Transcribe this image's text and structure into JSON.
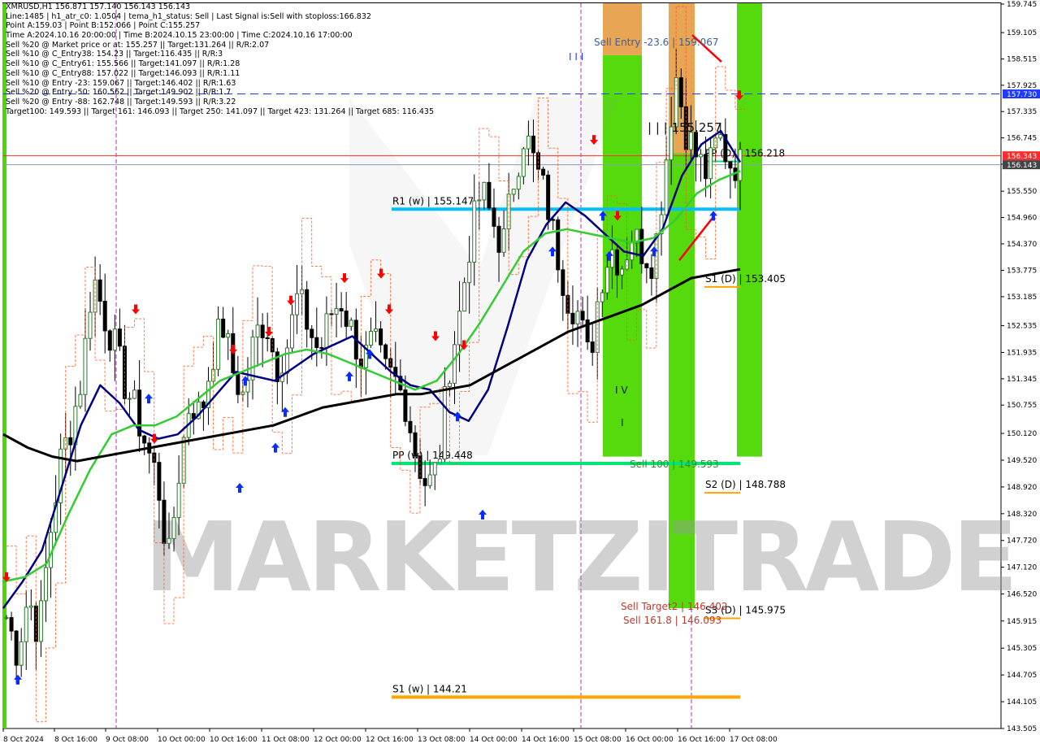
{
  "header": {
    "info_lines": [
      "XMRUSD,H1  156.871 157.140 156.143 156.143",
      "Line:1485  |  h1_atr_c0: 1.0504  |  tema_h1_status: Sell  |  Last Signal is:Sell with stoploss:166.832",
      "Point A:159.03  |  Point B:152.066  |  Point C:155.257",
      "Time A:2024.10.16 20:00:00  |  Time B:2024.10.15 23:00:00  |  Time C:2024.10.16 17:00:00",
      "Sell %20 @ Market price or at: 155.257  ||  Target:131.264  ||  R/R:2.07",
      "Sell %10 @ C_Entry38: 154.23  ||  Target:116.435  ||  R/R:3",
      "Sell %10 @ C_Entry61: 155.566  ||  Target:141.097  ||  R/R:1.28",
      "Sell %10 @ C_Entry88: 157.022  ||  Target:146.093  ||  R/R:1.11",
      "Sell %10 @ Entry -23: 159.067  ||  Target:146.402  ||  R/R:1.63",
      "Sell %20 @ Entry -50: 160.562  ||  Target:149.902  ||  R/R:1.7",
      "Sell %20 @ Entry -88: 162.748  ||  Target:149.593  ||  R/R:3.22",
      "Target100: 149.593  ||  Target 161: 146.093  ||  Target 250: 141.097  ||  Target 423: 131.264  ||  Target 685: 116.435"
    ]
  },
  "watermark": "MARKETZITRADE",
  "chart_data": {
    "type": "candlestick",
    "symbol": "XMRUSD",
    "timeframe": "H1",
    "ylim": [
      143.505,
      159.745
    ],
    "y_ticks": [
      "159.745",
      "159.105",
      "158.515",
      "157.925",
      "157.335",
      "156.745",
      "156.155",
      "155.550",
      "154.960",
      "154.370",
      "153.775",
      "153.185",
      "152.535",
      "151.935",
      "151.345",
      "150.755",
      "150.120",
      "149.520",
      "148.920",
      "148.320",
      "147.720",
      "147.120",
      "146.520",
      "145.915",
      "145.305",
      "144.705",
      "144.105",
      "143.505"
    ],
    "x_ticks": [
      "8 Oct 2024",
      "8 Oct 16:00",
      "9 Oct 08:00",
      "10 Oct 00:00",
      "10 Oct 16:00",
      "11 Oct 08:00",
      "12 Oct 00:00",
      "12 Oct 16:00",
      "13 Oct 08:00",
      "14 Oct 00:00",
      "14 Oct 16:00",
      "15 Oct 08:00",
      "16 Oct 00:00",
      "16 Oct 16:00",
      "17 Oct 08:00"
    ],
    "ohlc_close_path": [
      146.0,
      145.2,
      146.5,
      145.6,
      147.8,
      149.5,
      150.3,
      151.4,
      153.7,
      152.8,
      152.1,
      151.2,
      150.6,
      149.8,
      149.1,
      147.2,
      149.3,
      150.9,
      150.5,
      151.8,
      152.6,
      151.5,
      150.9,
      152.3,
      152.7,
      151.6,
      152.1,
      153.2,
      152.5,
      151.9,
      152.8,
      153.1,
      152.4,
      151.7,
      152.2,
      151.5,
      151.3,
      150.8,
      149.6,
      148.9,
      149.4,
      151.6,
      152.8,
      154.5,
      155.6,
      154.9,
      154.3,
      155.8,
      156.9,
      156.1,
      155.4,
      154.2,
      153.2,
      152.8,
      151.7,
      153.5,
      154.3,
      153.9,
      154.6,
      154.2,
      154.0,
      156.0,
      158.2,
      156.9,
      156.3,
      155.9,
      156.8,
      156.2,
      156.143
    ],
    "indicators": [
      {
        "name": "tema_h1",
        "color": "#000080",
        "values": [
          146.2,
          146.8,
          147.5,
          148.9,
          150.3,
          151.2,
          150.8,
          150.2,
          150.0,
          150.1,
          150.5,
          151.0,
          151.5,
          151.4,
          151.3,
          151.6,
          151.9,
          152.1,
          152.3,
          151.9,
          151.5,
          151.2,
          151.1,
          150.6,
          150.4,
          151.1,
          152.5,
          154.0,
          154.8,
          155.3,
          155.0,
          154.6,
          154.2,
          154.1,
          154.7,
          155.9,
          156.6,
          156.9,
          156.2
        ]
      },
      {
        "name": "ma_green",
        "color": "#33cc33",
        "values": [
          146.8,
          146.9,
          147.2,
          148.3,
          149.3,
          150.1,
          150.3,
          150.3,
          150.5,
          150.9,
          151.3,
          151.5,
          151.7,
          151.9,
          152.0,
          151.9,
          151.7,
          151.5,
          151.3,
          151.1,
          151.3,
          151.9,
          152.6,
          153.4,
          154.2,
          154.6,
          154.7,
          154.6,
          154.5,
          154.4,
          154.5,
          154.9,
          155.5,
          155.8,
          156.0
        ]
      },
      {
        "name": "ma_black",
        "color": "#000000",
        "values": [
          150.1,
          149.8,
          149.6,
          149.5,
          149.6,
          149.7,
          149.8,
          149.9,
          150.0,
          150.1,
          150.2,
          150.3,
          150.5,
          150.7,
          150.8,
          150.9,
          151.0,
          151.0,
          151.1,
          151.2,
          151.5,
          151.8,
          152.1,
          152.4,
          152.6,
          152.8,
          153.0,
          153.3,
          153.6,
          153.7,
          153.8
        ]
      }
    ],
    "levels": [
      {
        "label": "R1 (w) | 155.147",
        "value": 155.147,
        "color": "#00bfff"
      },
      {
        "label": "PP (w) | 149.448",
        "value": 149.448,
        "color": "#00e676"
      },
      {
        "label": "S1 (w) | 144.21",
        "value": 144.21,
        "color": "#ffa500"
      },
      {
        "label": "PP (D) | 156.218",
        "value": 156.218,
        "color": "#00e676"
      },
      {
        "label": "S1 (D) | 153.405",
        "value": 153.405,
        "color": "#ffa500"
      },
      {
        "label": "S2 (D) | 148.788",
        "value": 148.788,
        "color": "#ffa500"
      },
      {
        "label": "S3 (D) | 145.975",
        "value": 145.975,
        "color": "#ffa500"
      }
    ],
    "annotations": {
      "sell_entry": "Sell Entry -23.6 | 159.067",
      "point_c": "| | | 155.257",
      "sell_100": "Sell 100 | 149.593",
      "sell_target2": "Sell Target2 | 146.402",
      "sell_161": "Sell 161.8 | 146.093",
      "iv": "I V",
      "i": "I",
      "iii": "I I I"
    },
    "price_badges": [
      {
        "text": "157.730",
        "value": 157.73,
        "color": "#1e3cff"
      },
      {
        "text": "156.343",
        "value": 156.343,
        "color": "#ff2b2b"
      },
      {
        "text": "156.143",
        "value": 156.143,
        "color": "#444444"
      }
    ],
    "colors": {
      "green_zone": "#4cd900",
      "orange_zone": "#e7a04a",
      "bull_candle": "#2d7a2d",
      "bear_candle": "#000000",
      "resistance": "#ff0000",
      "stop_dash": "#ff5a1f"
    }
  }
}
